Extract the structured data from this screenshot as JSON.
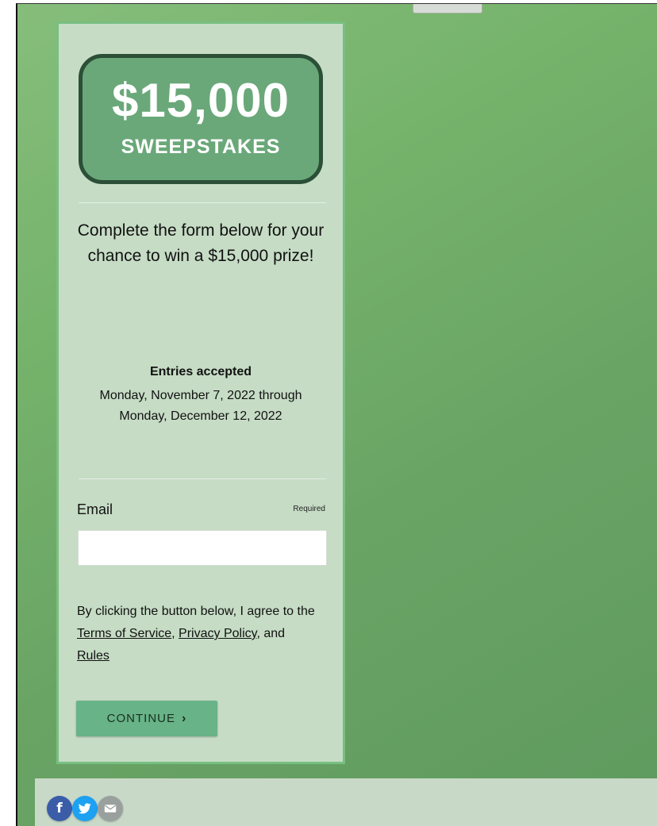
{
  "badge": {
    "amount": "$15,000",
    "subtitle": "SWEEPSTAKES"
  },
  "lead_text": "Complete the form below for your chance to win a $15,000 prize!",
  "entries": {
    "title": "Entries accepted",
    "dates": "Monday, November 7, 2022 through Monday, December 12, 2022"
  },
  "form": {
    "email_label": "Email",
    "required_label": "Required",
    "email_value": "",
    "consent_prefix": "By clicking the button below, I agree to the",
    "terms_link": "Terms of Service",
    "comma": ",",
    "privacy_link": "Privacy Policy",
    "and_text": ", and",
    "rules_link": "Rules",
    "continue_label": "CONTINUE",
    "continue_chevron": "›"
  },
  "social": {
    "facebook_glyph": "f",
    "icons": [
      "facebook-icon",
      "twitter-icon",
      "email-icon"
    ]
  },
  "colors": {
    "page_green": "#75b36b",
    "panel_bg": "#c6dcc5",
    "panel_border": "#78bf82",
    "badge_fill": "#6aa879",
    "badge_border": "#2b4f37",
    "button": "#68b387",
    "facebook": "#3b5da8",
    "twitter": "#1da1f2",
    "email": "#9aa09d"
  }
}
